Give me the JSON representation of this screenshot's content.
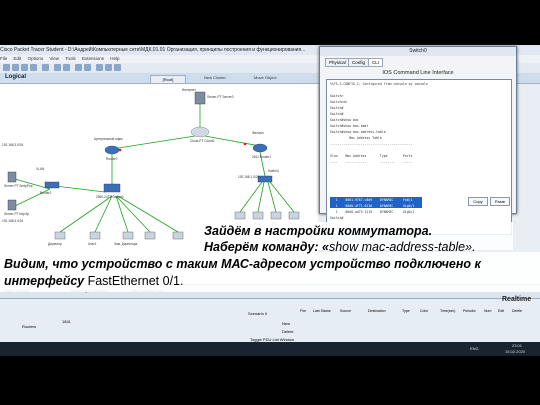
{
  "window": {
    "title": "Cisco Packet Tracer Student - D:\\Андрей\\Компьютерные сети\\МДК.01.01 Организация, принципы построения и функционирования..."
  },
  "menu": [
    "File",
    "Edit",
    "Options",
    "View",
    "Tools",
    "Extensions",
    "Help"
  ],
  "workspace": {
    "mode_label": "Logical",
    "root_label": "[Root]",
    "new_cluster": "New Cluster",
    "move_object": "Move Object"
  },
  "network": {
    "internet_label": "Интернет",
    "central_office_label": "Центральный офис",
    "branch_label": "Филиал",
    "net_left_top": "192.168.3.0/24",
    "net_left_bottom": "192.168.4.0/24",
    "net_right": "192.168.1.0/24",
    "vlan_label": "VLAN",
    "devices": [
      {
        "name": "Server-PT Server0"
      },
      {
        "name": "Cloud-PT Cloud0"
      },
      {
        "name": "Router0"
      },
      {
        "name": "2811 Router1"
      },
      {
        "name": "Router2"
      },
      {
        "name": "2960-24TT Switch0"
      },
      {
        "name": "Multilayer Switch0"
      },
      {
        "name": "Switch1"
      },
      {
        "name": "Server-PT SmtpPop"
      },
      {
        "name": "Server-PT http.ftp"
      },
      {
        "name": "Директор"
      },
      {
        "name": "Зам. Директора"
      },
      {
        "name": "User1"
      },
      {
        "name": "PC5"
      },
      {
        "name": "PC4"
      },
      {
        "name": "PC7"
      },
      {
        "name": "PC3"
      }
    ]
  },
  "switch_window": {
    "title": "Switch0",
    "tabs": [
      "Physical",
      "Config",
      "CLI"
    ],
    "cli_title": "IOS Command Line Interface",
    "cli_lines": [
      "%SYS-5-CONFIG_I: Configured from console by console",
      "",
      "Switch>",
      "Switch>en",
      "Switch#",
      "Switch#",
      "Switch#show mac",
      "Switch#show mac-addr",
      "Switch#show mac-address-table",
      "          Mac Address Table",
      "-------------------------------------------",
      "",
      "Vlan    Mac Address       Type        Ports",
      "----    -----------       --------    -----",
      "",
      "   1    0001.9767.c8e9    DYNAMIC     Fa0/1",
      "   1    0060.4f71.0116    DYNAMIC     Gig0/1",
      "   1    00d0.ad75.3119    DYNAMIC     Gig0/1",
      "Switch#"
    ],
    "copy_label": "Copy",
    "paste_label": "Paste"
  },
  "caption": {
    "line1": "Зайдём в настройки коммутатора.",
    "line2_a": "Наберём команду: «",
    "line2_b": "show mac-address-table",
    "line2_c": "».",
    "line3": "Видим, что устройство с таким МАС-адресом устройство подключено к",
    "line4_a": "интерфейсу ",
    "line4_b": "FastEthernet 0/1",
    "line4_c": "."
  },
  "status": {
    "time": "Time: 00:09:07",
    "power_cycle": "Power Cycle Devices",
    "fast_forward": "Fast Forward Time",
    "realtime": "Realtime"
  },
  "device_panel": {
    "category": "Routers",
    "selected_model": "1841",
    "pdu_columns": [
      "Fire",
      "Last Status",
      "Source",
      "Destination",
      "Type",
      "Color",
      "Time(sec)",
      "Periodic",
      "Num",
      "Edit",
      "Delete"
    ],
    "scenario": "Scenario 0",
    "new_label": "New",
    "delete_label": "Delete",
    "toggle_pdu": "Toggle PDU List Window"
  },
  "taskbar": {
    "lang": "ENG",
    "time": "23:01",
    "date": "15.02.2020"
  },
  "colors": {
    "highlight": "#1f63c6",
    "link_green": "#1aa31a",
    "link_red": "#d42020"
  }
}
